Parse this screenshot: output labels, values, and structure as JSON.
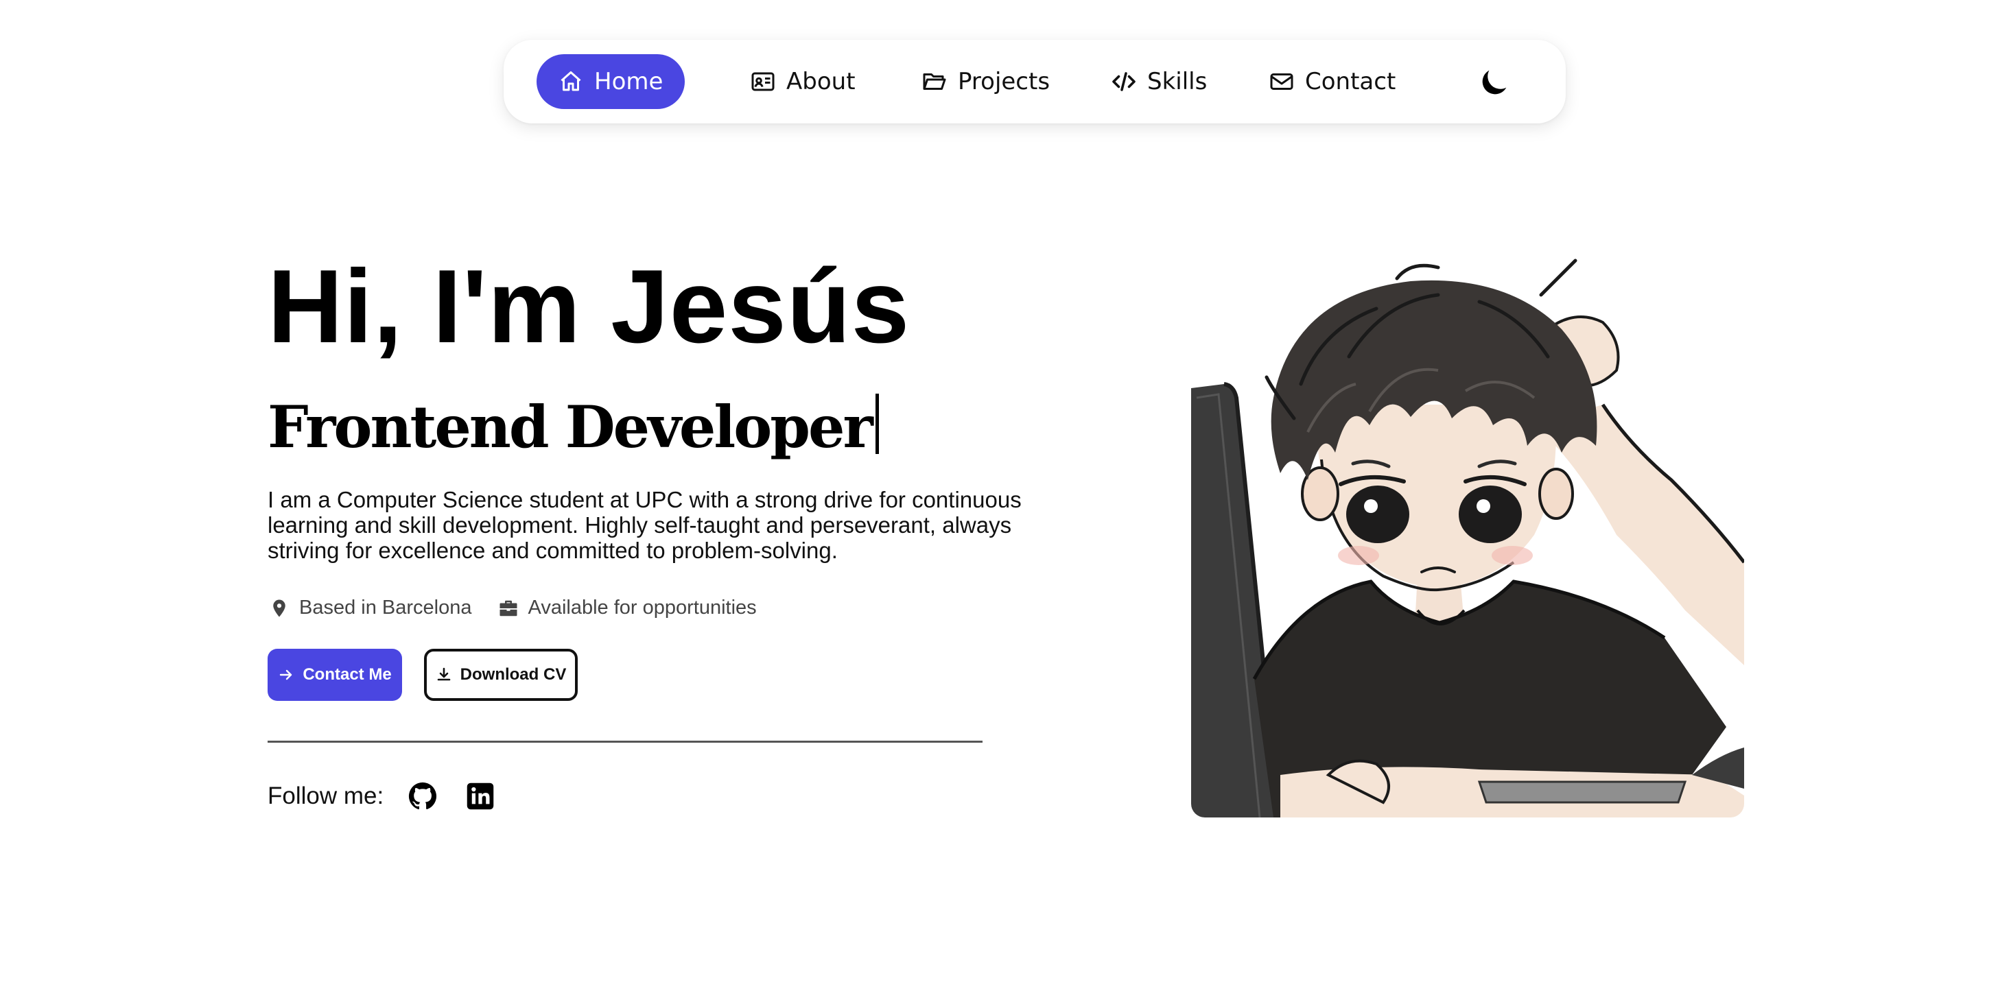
{
  "nav": {
    "items": [
      {
        "label": "Home",
        "icon": "home-icon",
        "active": true
      },
      {
        "label": "About",
        "icon": "id-card-icon",
        "active": false
      },
      {
        "label": "Projects",
        "icon": "folder-icon",
        "active": false
      },
      {
        "label": "Skills",
        "icon": "code-icon",
        "active": false
      },
      {
        "label": "Contact",
        "icon": "envelope-icon",
        "active": false
      }
    ],
    "theme_toggle_icon": "moon-icon"
  },
  "hero": {
    "title": "Hi, I'm Jesús",
    "role": "Frontend Developer",
    "description": "I am a Computer Science student at UPC with a strong drive for continuous learning and skill development. Highly self-taught and perseverant, always striving for excellence and committed to problem-solving.",
    "location": "Based in Barcelona",
    "availability": "Available for opportunities",
    "contact_button": "Contact Me",
    "download_button": "Download CV",
    "follow_label": "Follow me:",
    "social_icons": [
      "github-icon",
      "linkedin-icon"
    ]
  },
  "colors": {
    "accent": "#4a46e1",
    "text": "#111111",
    "muted": "#444444",
    "background": "#ffffff"
  }
}
